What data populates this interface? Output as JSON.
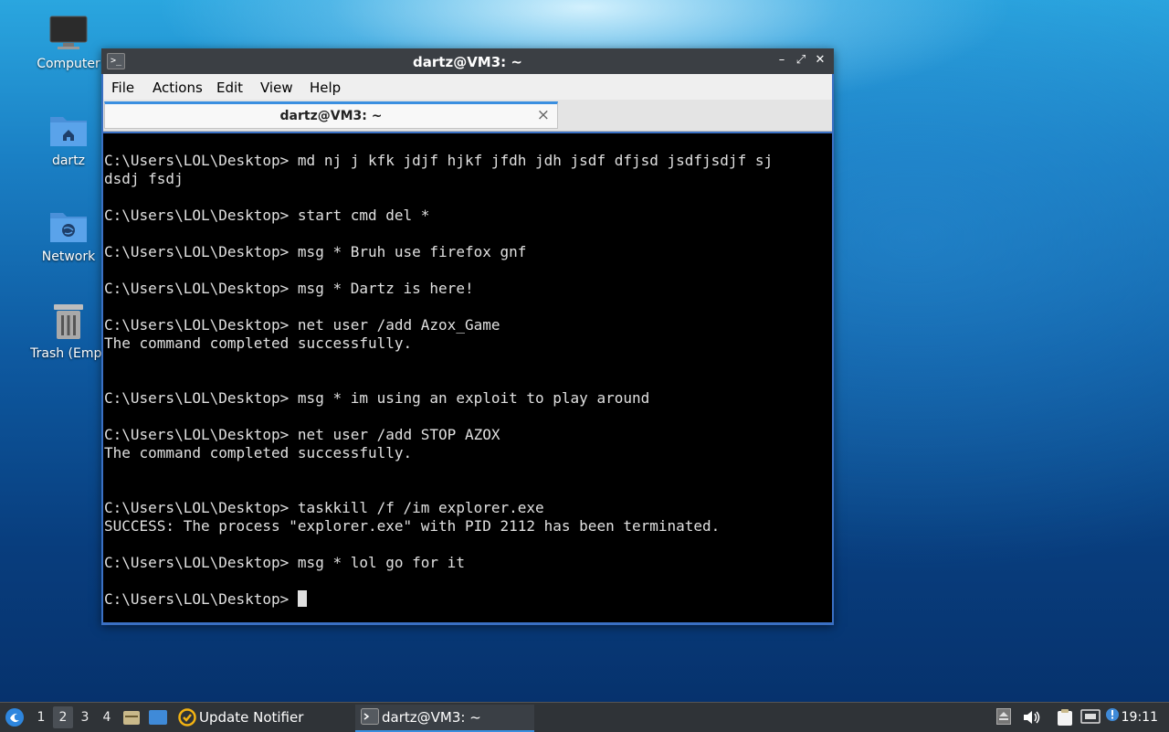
{
  "desktop": {
    "icons": [
      {
        "label": "Computer",
        "icon": "monitor-icon"
      },
      {
        "label": "dartz",
        "icon": "home-folder-icon"
      },
      {
        "label": "Network",
        "icon": "network-folder-icon"
      },
      {
        "label": "Trash (Empt",
        "icon": "trash-icon"
      }
    ]
  },
  "window": {
    "title": "dartz@VM3: ~",
    "controls": {
      "minimize": "–",
      "maximize": "⤢",
      "close": "✕"
    },
    "menu": [
      "File",
      "Actions",
      "Edit",
      "View",
      "Help"
    ],
    "tab": {
      "label": "dartz@VM3: ~",
      "close": "×"
    }
  },
  "terminal": {
    "lines": [
      "C:\\Users\\LOL\\Desktop> md nj j kfk jdjf hjkf jfdh jdh jsdf dfjsd jsdfjsdjf sj",
      "dsdj fsdj",
      "",
      "C:\\Users\\LOL\\Desktop> start cmd del *",
      "",
      "C:\\Users\\LOL\\Desktop> msg * Bruh use firefox gnf",
      "",
      "C:\\Users\\LOL\\Desktop> msg * Dartz is here!",
      "",
      "C:\\Users\\LOL\\Desktop> net user /add Azox_Game",
      "The command completed successfully.",
      "",
      "",
      "C:\\Users\\LOL\\Desktop> msg * im using an exploit to play around",
      "",
      "C:\\Users\\LOL\\Desktop> net user /add STOP AZOX",
      "The command completed successfully.",
      "",
      "",
      "C:\\Users\\LOL\\Desktop> taskkill /f /im explorer.exe",
      "SUCCESS: The process \"explorer.exe\" with PID 2112 has been terminated.",
      "",
      "C:\\Users\\LOL\\Desktop> msg * lol go for it",
      ""
    ],
    "prompt": "C:\\Users\\LOL\\Desktop> "
  },
  "taskbar": {
    "workspaces": [
      "1",
      "2",
      "3",
      "4"
    ],
    "active_workspace": "2",
    "tasks": [
      {
        "label": "Update Notifier",
        "icon": "update-notifier-icon"
      },
      {
        "label": "dartz@VM3: ~",
        "icon": "terminal-icon"
      }
    ],
    "clock": "19:11"
  }
}
